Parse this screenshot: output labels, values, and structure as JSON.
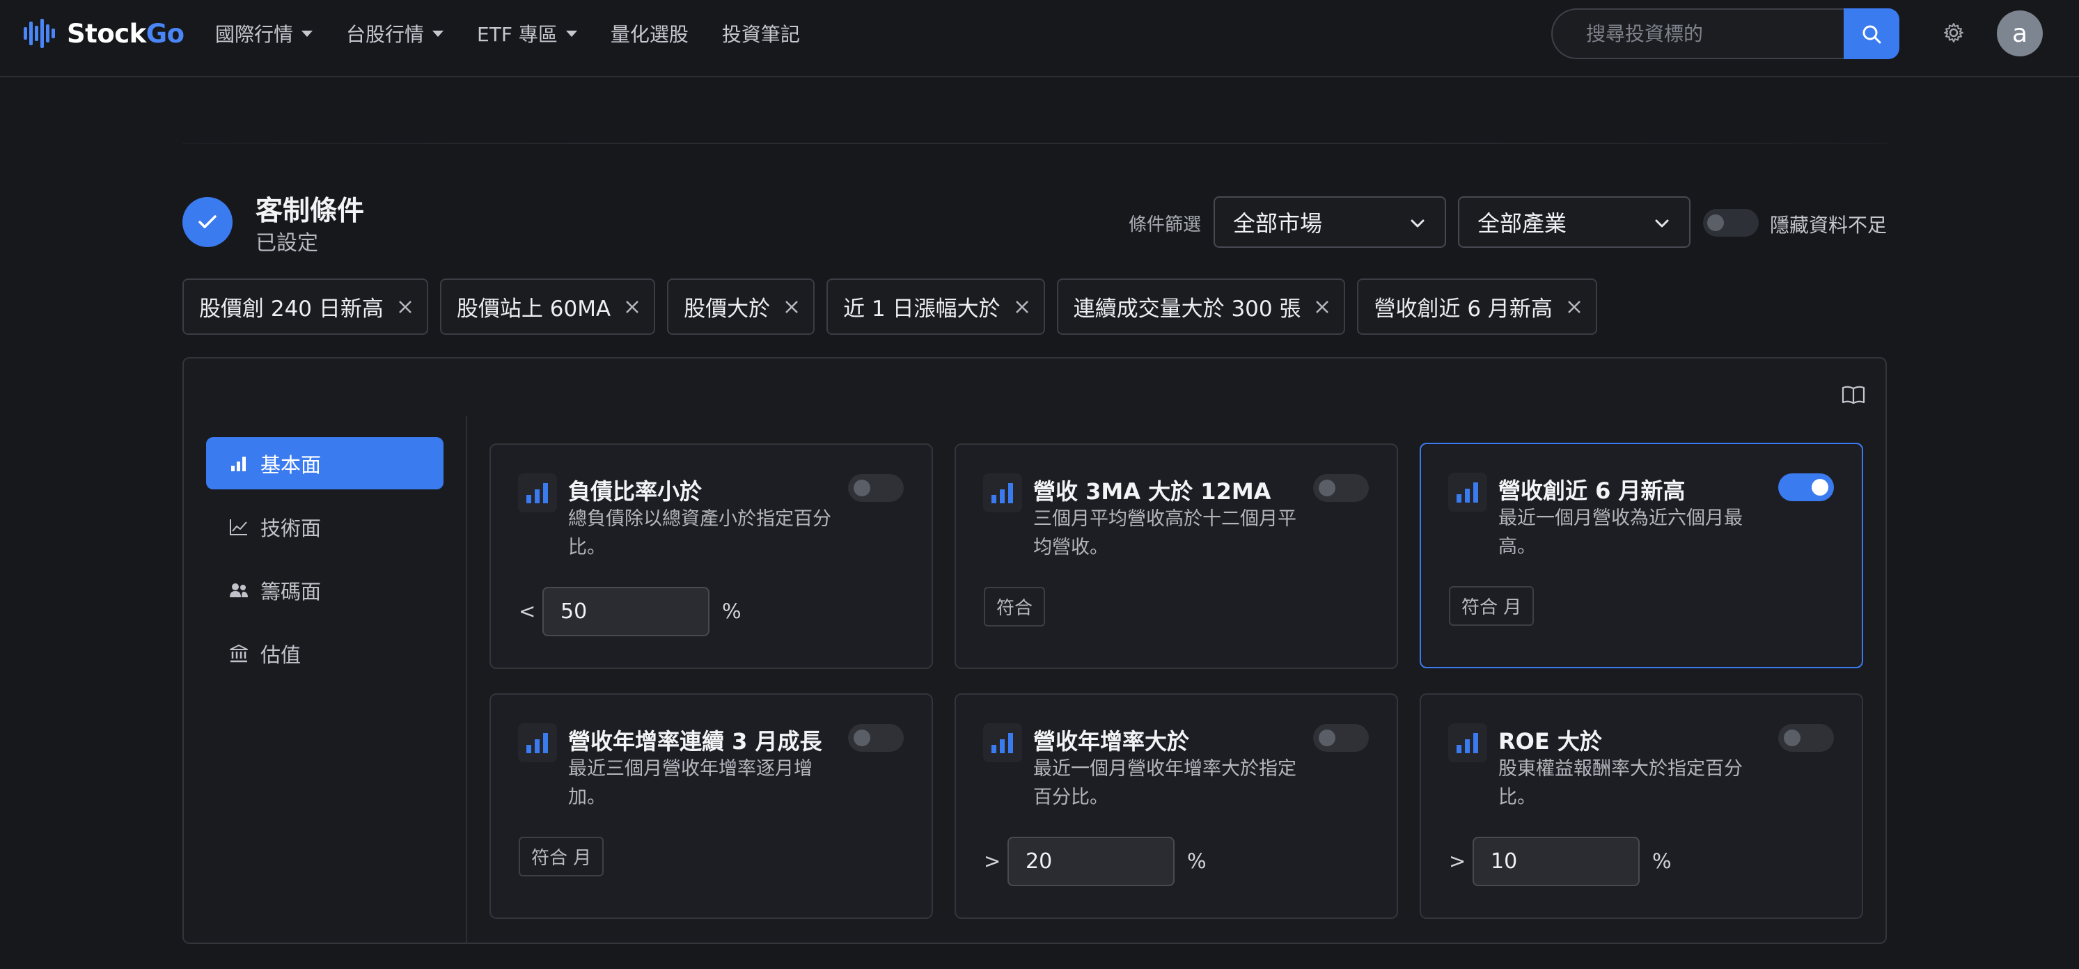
{
  "brand": {
    "name_part1": "Stock",
    "name_part2": "Go",
    "accent": "#4a86f7"
  },
  "nav": {
    "items": [
      {
        "label": "國際行情",
        "has_caret": true
      },
      {
        "label": "台股行情",
        "has_caret": true
      },
      {
        "label": "ETF 專區",
        "has_caret": true
      },
      {
        "label": "量化選股",
        "has_caret": false
      },
      {
        "label": "投資筆記",
        "has_caret": false
      }
    ],
    "search_placeholder": "搜尋投資標的",
    "search_icon": "search-icon",
    "settings_icon": "gear-icon",
    "avatar_letter": "a"
  },
  "header": {
    "title": "客制條件",
    "subtitle": "已設定",
    "filter_label": "條件篩選",
    "market_select": "全部市場",
    "industry_select": "全部產業",
    "hide_insufficient_label": "隱藏資料不足",
    "hide_insufficient_on": false
  },
  "tags": [
    "股價創 240 日新高",
    "股價站上 60MA",
    "股價大於",
    "近 1 日漲幅大於",
    "連續成交量大於 300 張",
    "營收創近 6 月新高"
  ],
  "sidebar": {
    "items": [
      {
        "label": "基本面",
        "icon": "bar-chart-icon",
        "active": true
      },
      {
        "label": "技術面",
        "icon": "trend-line-icon",
        "active": false
      },
      {
        "label": "籌碼面",
        "icon": "users-icon",
        "active": false
      },
      {
        "label": "估值",
        "icon": "bank-icon",
        "active": false
      }
    ]
  },
  "cards": [
    {
      "title": "負債比率小於",
      "desc": "總負債除以總資產小於指定百分比。",
      "enabled": false,
      "operator": "<",
      "value": "50",
      "unit": "%"
    },
    {
      "title": "營收 3MA 大於 12MA",
      "desc": "三個月平均營收高於十二個月平均營收。",
      "enabled": false,
      "badge": "符合"
    },
    {
      "title": "營收創近 6 月新高",
      "desc": "最近一個月營收為近六個月最高。",
      "enabled": true,
      "badge": "符合 月"
    },
    {
      "title": "營收年增率連續 3 月成長",
      "desc": "最近三個月營收年增率逐月增加。",
      "enabled": false,
      "badge": "符合 月"
    },
    {
      "title": "營收年增率大於",
      "desc": "最近一個月營收年增率大於指定百分比。",
      "enabled": false,
      "operator": ">",
      "value": "20",
      "unit": "%"
    },
    {
      "title": "ROE 大於",
      "desc": "股東權益報酬率大於指定百分比。",
      "enabled": false,
      "operator": ">",
      "value": "10",
      "unit": "%"
    }
  ],
  "colors": {
    "primary": "#3b7bf0",
    "background": "#17181c",
    "card": "#1d1e23"
  }
}
